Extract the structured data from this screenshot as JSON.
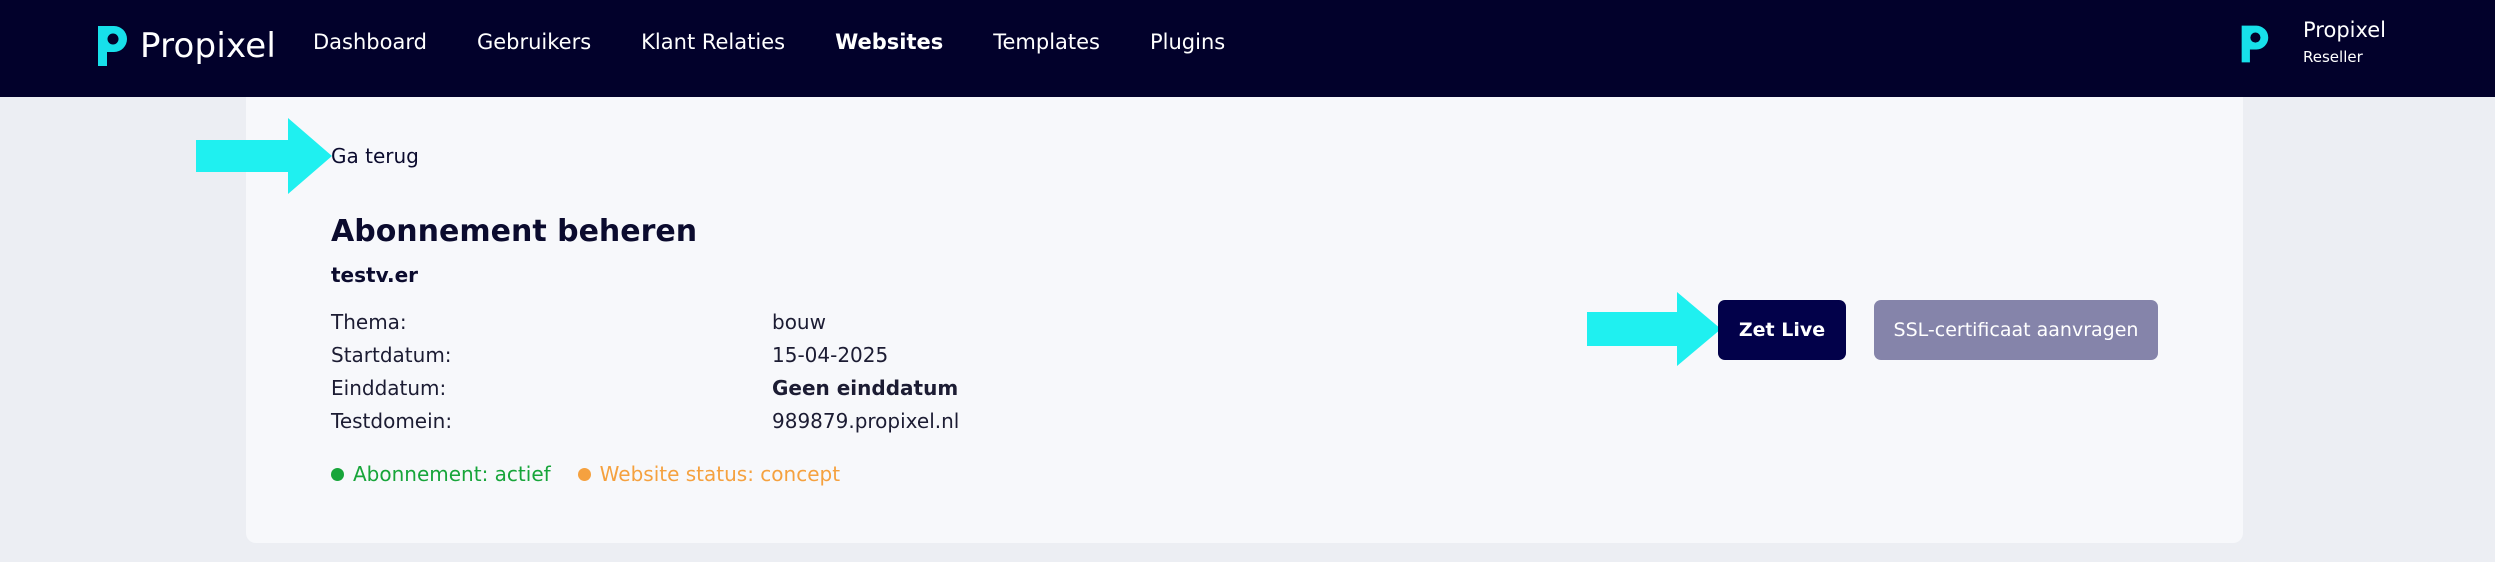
{
  "header": {
    "brand": "Propixel",
    "nav": [
      {
        "label": "Dashboard",
        "active": false
      },
      {
        "label": "Gebruikers",
        "active": false
      },
      {
        "label": "Klant Relaties",
        "active": false
      },
      {
        "label": "Websites",
        "active": true
      },
      {
        "label": "Templates",
        "active": false
      },
      {
        "label": "Plugins",
        "active": false
      }
    ],
    "user": {
      "name": "Propixel",
      "role": "Reseller"
    }
  },
  "main": {
    "back_label": "Ga terug",
    "title": "Abonnement beheren",
    "domain": "testv.er",
    "details": [
      {
        "label": "Thema:",
        "value": "bouw"
      },
      {
        "label": "Startdatum:",
        "value": "15-04-2025"
      },
      {
        "label": "Einddatum:",
        "value": "Geen einddatum"
      },
      {
        "label": "Testdomein:",
        "value": "989879.propixel.nl"
      }
    ],
    "status": {
      "subscription": "Abonnement: actief",
      "website": "Website status: concept"
    },
    "actions": {
      "go_live": "Zet Live",
      "ssl": "SSL-certificaat aanvragen"
    }
  },
  "colors": {
    "header_bg": "#02012b",
    "brand_accent": "#17e0ea",
    "primary_button": "#02014a",
    "disabled_button": "#8584aa",
    "status_active": "#17a53a",
    "status_concept": "#f5a13f",
    "annotation_arrow": "#1ff0f0"
  },
  "icons": {
    "logo": "propixel-logo-icon",
    "annotation": "arrow-right-icon"
  }
}
